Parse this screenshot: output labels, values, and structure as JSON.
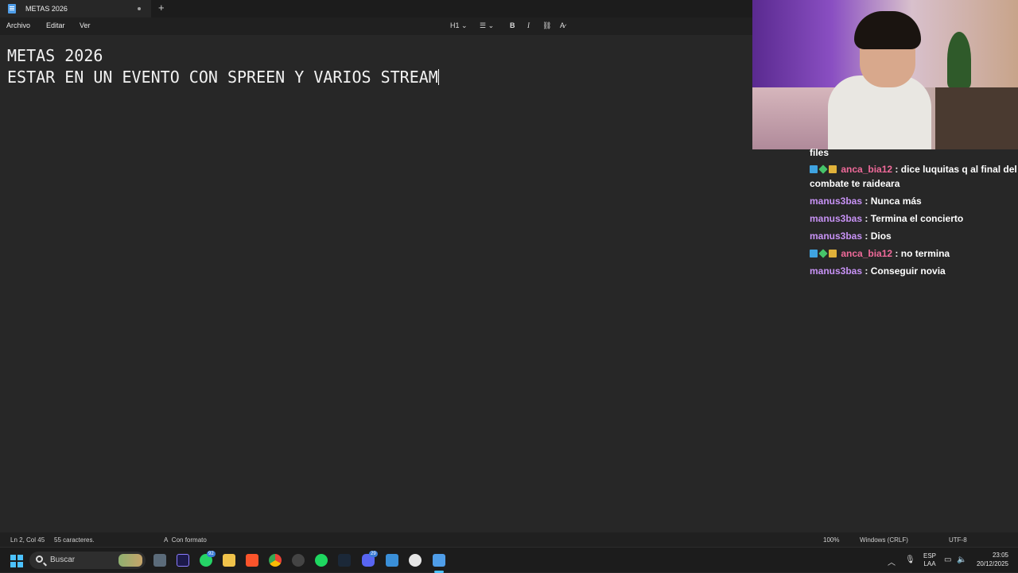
{
  "tab": {
    "title": "METAS 2026",
    "new_tab": "+"
  },
  "menu": {
    "items": [
      "Archivo",
      "Editar",
      "Ver"
    ]
  },
  "toolbar": {
    "heading": "H1",
    "list": "☰",
    "bold": "B",
    "italic": "I",
    "link": "🔗",
    "clear_format": "A̷"
  },
  "document": {
    "line1": "METAS 2026",
    "line2": "ESTAR EN UN EVENTO CON SPREEN Y VARIOS STREAM"
  },
  "chat": {
    "partial": "files",
    "messages": [
      {
        "user": "anca_bia12",
        "text": ": dice luquitas q al final del combate te raideara",
        "badges": true,
        "color": "#f06a9a"
      },
      {
        "user": "manus3bas",
        "text": ": Nunca más",
        "badges": false,
        "color": "#c792f5"
      },
      {
        "user": "manus3bas",
        "text": ": Termina el concierto",
        "badges": false,
        "color": "#c792f5"
      },
      {
        "user": "manus3bas",
        "text": ": Dios",
        "badges": false,
        "color": "#c792f5"
      },
      {
        "user": "anca_bia12",
        "text": ": no termina",
        "badges": true,
        "color": "#f06a9a"
      },
      {
        "user": "manus3bas",
        "text": ": Conseguir novia",
        "badges": false,
        "color": "#c792f5"
      }
    ]
  },
  "status": {
    "position": "Ln 2, Col 45",
    "chars": "55 caracteres.",
    "format": "Con formato",
    "zoom": "100%",
    "line_ending": "Windows (CRLF)",
    "encoding": "UTF-8"
  },
  "taskbar": {
    "search_placeholder": "Buscar",
    "whatsapp_badge": "92",
    "discord_badge": "29",
    "lang_line1": "ESP",
    "lang_line2": "LAA",
    "time": "23:05",
    "date": "20/12/2025"
  },
  "colors": {
    "accent": "#4cc2ff",
    "chat_pink": "#f06a9a",
    "chat_purple": "#c792f5"
  }
}
